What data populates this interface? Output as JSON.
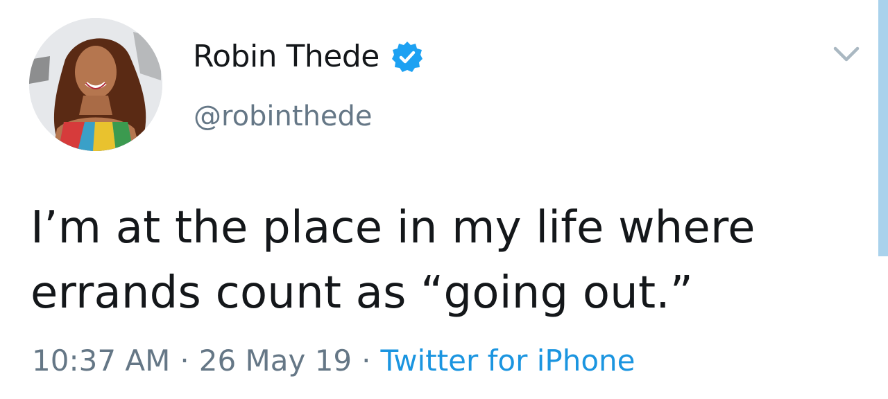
{
  "author": {
    "display_name": "Robin Thede",
    "handle": "@robinthede",
    "verified": true,
    "avatar_icon": "profile-photo"
  },
  "menu_icon": "chevron-down-icon",
  "tweet": {
    "text": "I’m at the place in my life where\nerrands count as “going out.”"
  },
  "meta": {
    "time": "10:37 AM",
    "separator": "·",
    "date": "26 May 19",
    "source": "Twitter for iPhone"
  },
  "colors": {
    "verified_badge": "#1da1f2",
    "link": "#1b95e0",
    "secondary_text": "#657786",
    "primary_text": "#14171a"
  }
}
